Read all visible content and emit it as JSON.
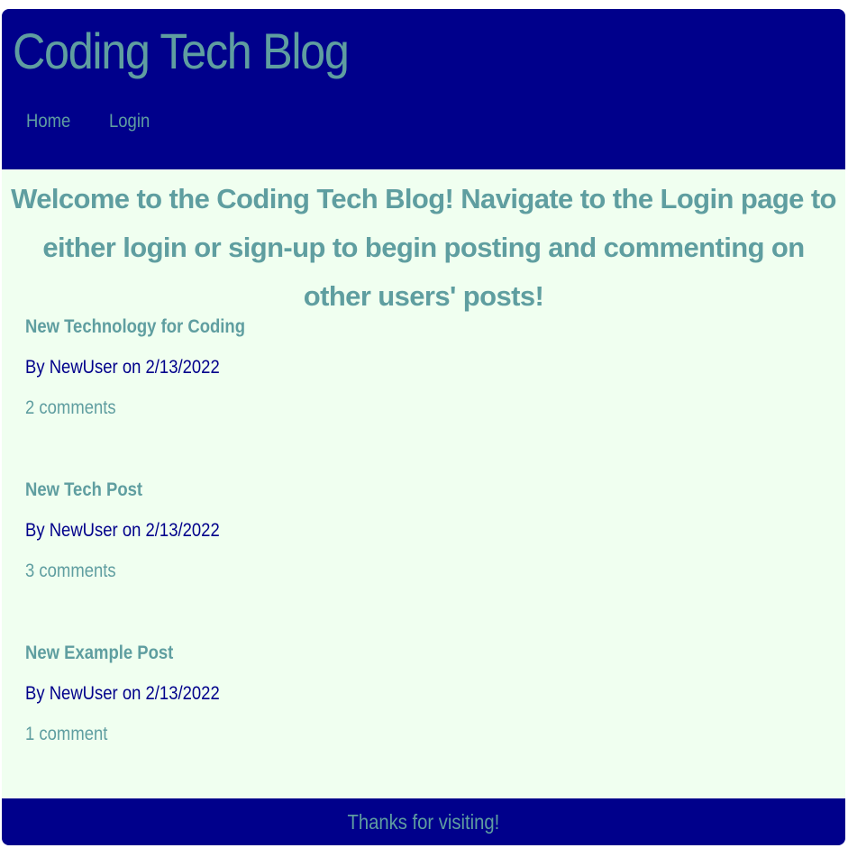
{
  "header": {
    "title": "Coding Tech Blog",
    "nav": {
      "home": "Home",
      "login": "Login"
    }
  },
  "main": {
    "welcome": "Welcome to the Coding Tech Blog! Navigate to the Login page to either login or sign-up to begin posting and commenting on other users' posts!",
    "posts": [
      {
        "title": "New Technology for Coding",
        "meta": "By NewUser on 2/13/2022",
        "comments": "2 comments"
      },
      {
        "title": "New Tech Post",
        "meta": "By NewUser on 2/13/2022",
        "comments": "3 comments"
      },
      {
        "title": "New Example Post",
        "meta": "By NewUser on 2/13/2022",
        "comments": "1 comment"
      }
    ]
  },
  "footer": {
    "text": "Thanks for visiting!"
  },
  "colors": {
    "header_bg": "#00008B",
    "accent": "#5F9EA0",
    "page_bg": "#F0FFF0"
  }
}
